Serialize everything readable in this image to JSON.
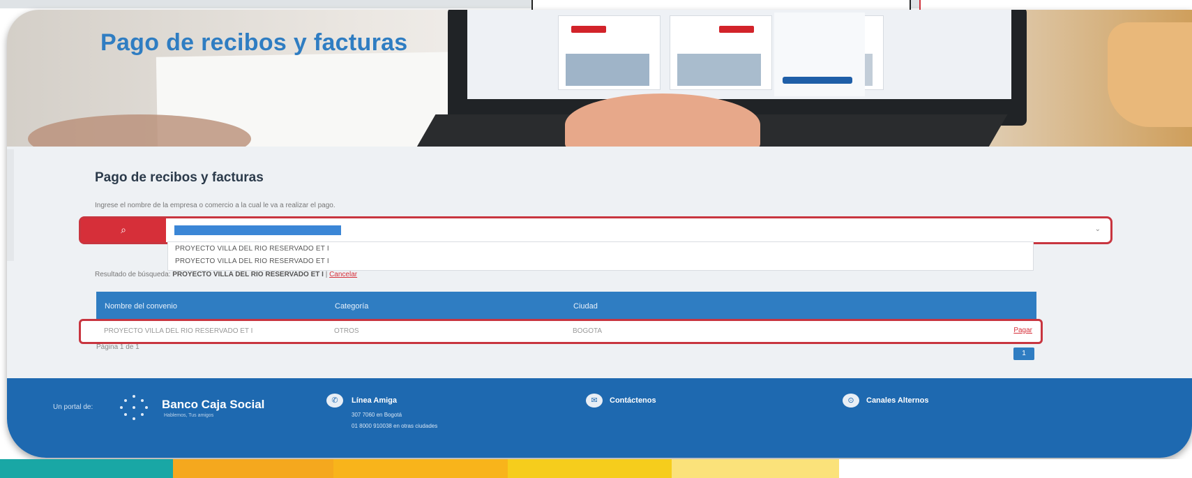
{
  "banner": {
    "title": "Pago de recibos y facturas"
  },
  "main": {
    "section_title": "Pago de recibos y facturas",
    "instruction": "Ingrese el nombre de la empresa o comercio a la cual le va a realizar el pago.",
    "search": {
      "button_icon": "search-icon",
      "button_glyph": "⌕",
      "value": "PROYECTO VILLA DEL RIO RESERVADO ET I",
      "caret_glyph": "⌄"
    },
    "dropdown_options": [
      "PROYECTO VILLA DEL RIO RESERVADO ET I",
      "PROYECTO VILLA DEL RIO RESERVADO ET I"
    ],
    "result": {
      "label": "Resultado de búsqueda:",
      "query": "PROYECTO VILLA DEL RIO RESERVADO ET I",
      "separator": "|",
      "cancel": "Cancelar"
    },
    "table": {
      "headers": [
        "Nombre del convenio",
        "Categoría",
        "Ciudad"
      ],
      "rows": [
        {
          "name": "PROYECTO VILLA DEL RIO RESERVADO ET I",
          "category": "OTROS",
          "city": "BOGOTA",
          "action": "Pagar"
        }
      ]
    },
    "pager": {
      "text": "Página 1 de 1",
      "button": "1"
    }
  },
  "footer": {
    "prefix": "Un portal de:",
    "brand": "Banco Caja Social",
    "tagline": "Hablemos, Tus amigos",
    "items": [
      {
        "icon": "phone-icon",
        "label": "Línea Amiga",
        "sub": [
          "307 7060 en Bogotá",
          "01 8000 910038 en otras ciudades"
        ]
      },
      {
        "icon": "chat-icon",
        "label": "Contáctenos"
      },
      {
        "icon": "location-icon",
        "label": "Canales Alternos"
      }
    ]
  },
  "colors": {
    "brand_blue": "#2f7dc2",
    "footer_blue": "#1e69b0",
    "search_red": "#d62f39",
    "highlight_red": "#c8353f",
    "bottom_bar": [
      "#19a7a5",
      "#f5a81e",
      "#f8b41b",
      "#f6cd1c",
      "#fbe27a",
      "#ffffff"
    ]
  }
}
